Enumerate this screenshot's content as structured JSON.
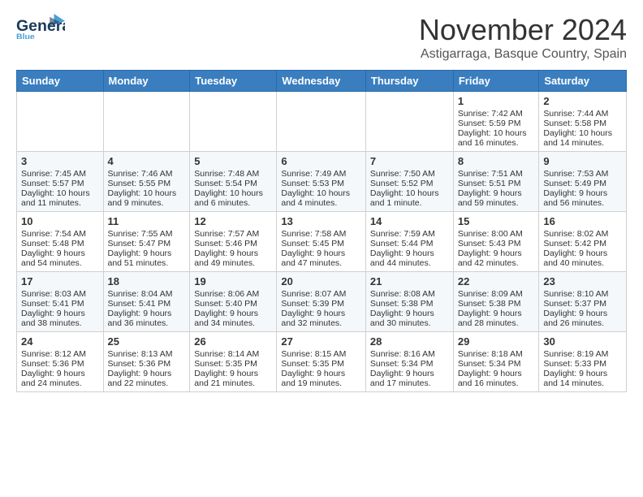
{
  "header": {
    "logo_general": "General",
    "logo_blue": "Blue",
    "month": "November 2024",
    "location": "Astigarraga, Basque Country, Spain"
  },
  "weekdays": [
    "Sunday",
    "Monday",
    "Tuesday",
    "Wednesday",
    "Thursday",
    "Friday",
    "Saturday"
  ],
  "weeks": [
    [
      {
        "day": "",
        "info": ""
      },
      {
        "day": "",
        "info": ""
      },
      {
        "day": "",
        "info": ""
      },
      {
        "day": "",
        "info": ""
      },
      {
        "day": "",
        "info": ""
      },
      {
        "day": "1",
        "info": "Sunrise: 7:42 AM\nSunset: 5:59 PM\nDaylight: 10 hours and 16 minutes."
      },
      {
        "day": "2",
        "info": "Sunrise: 7:44 AM\nSunset: 5:58 PM\nDaylight: 10 hours and 14 minutes."
      }
    ],
    [
      {
        "day": "3",
        "info": "Sunrise: 7:45 AM\nSunset: 5:57 PM\nDaylight: 10 hours and 11 minutes."
      },
      {
        "day": "4",
        "info": "Sunrise: 7:46 AM\nSunset: 5:55 PM\nDaylight: 10 hours and 9 minutes."
      },
      {
        "day": "5",
        "info": "Sunrise: 7:48 AM\nSunset: 5:54 PM\nDaylight: 10 hours and 6 minutes."
      },
      {
        "day": "6",
        "info": "Sunrise: 7:49 AM\nSunset: 5:53 PM\nDaylight: 10 hours and 4 minutes."
      },
      {
        "day": "7",
        "info": "Sunrise: 7:50 AM\nSunset: 5:52 PM\nDaylight: 10 hours and 1 minute."
      },
      {
        "day": "8",
        "info": "Sunrise: 7:51 AM\nSunset: 5:51 PM\nDaylight: 9 hours and 59 minutes."
      },
      {
        "day": "9",
        "info": "Sunrise: 7:53 AM\nSunset: 5:49 PM\nDaylight: 9 hours and 56 minutes."
      }
    ],
    [
      {
        "day": "10",
        "info": "Sunrise: 7:54 AM\nSunset: 5:48 PM\nDaylight: 9 hours and 54 minutes."
      },
      {
        "day": "11",
        "info": "Sunrise: 7:55 AM\nSunset: 5:47 PM\nDaylight: 9 hours and 51 minutes."
      },
      {
        "day": "12",
        "info": "Sunrise: 7:57 AM\nSunset: 5:46 PM\nDaylight: 9 hours and 49 minutes."
      },
      {
        "day": "13",
        "info": "Sunrise: 7:58 AM\nSunset: 5:45 PM\nDaylight: 9 hours and 47 minutes."
      },
      {
        "day": "14",
        "info": "Sunrise: 7:59 AM\nSunset: 5:44 PM\nDaylight: 9 hours and 44 minutes."
      },
      {
        "day": "15",
        "info": "Sunrise: 8:00 AM\nSunset: 5:43 PM\nDaylight: 9 hours and 42 minutes."
      },
      {
        "day": "16",
        "info": "Sunrise: 8:02 AM\nSunset: 5:42 PM\nDaylight: 9 hours and 40 minutes."
      }
    ],
    [
      {
        "day": "17",
        "info": "Sunrise: 8:03 AM\nSunset: 5:41 PM\nDaylight: 9 hours and 38 minutes."
      },
      {
        "day": "18",
        "info": "Sunrise: 8:04 AM\nSunset: 5:41 PM\nDaylight: 9 hours and 36 minutes."
      },
      {
        "day": "19",
        "info": "Sunrise: 8:06 AM\nSunset: 5:40 PM\nDaylight: 9 hours and 34 minutes."
      },
      {
        "day": "20",
        "info": "Sunrise: 8:07 AM\nSunset: 5:39 PM\nDaylight: 9 hours and 32 minutes."
      },
      {
        "day": "21",
        "info": "Sunrise: 8:08 AM\nSunset: 5:38 PM\nDaylight: 9 hours and 30 minutes."
      },
      {
        "day": "22",
        "info": "Sunrise: 8:09 AM\nSunset: 5:38 PM\nDaylight: 9 hours and 28 minutes."
      },
      {
        "day": "23",
        "info": "Sunrise: 8:10 AM\nSunset: 5:37 PM\nDaylight: 9 hours and 26 minutes."
      }
    ],
    [
      {
        "day": "24",
        "info": "Sunrise: 8:12 AM\nSunset: 5:36 PM\nDaylight: 9 hours and 24 minutes."
      },
      {
        "day": "25",
        "info": "Sunrise: 8:13 AM\nSunset: 5:36 PM\nDaylight: 9 hours and 22 minutes."
      },
      {
        "day": "26",
        "info": "Sunrise: 8:14 AM\nSunset: 5:35 PM\nDaylight: 9 hours and 21 minutes."
      },
      {
        "day": "27",
        "info": "Sunrise: 8:15 AM\nSunset: 5:35 PM\nDaylight: 9 hours and 19 minutes."
      },
      {
        "day": "28",
        "info": "Sunrise: 8:16 AM\nSunset: 5:34 PM\nDaylight: 9 hours and 17 minutes."
      },
      {
        "day": "29",
        "info": "Sunrise: 8:18 AM\nSunset: 5:34 PM\nDaylight: 9 hours and 16 minutes."
      },
      {
        "day": "30",
        "info": "Sunrise: 8:19 AM\nSunset: 5:33 PM\nDaylight: 9 hours and 14 minutes."
      }
    ]
  ]
}
